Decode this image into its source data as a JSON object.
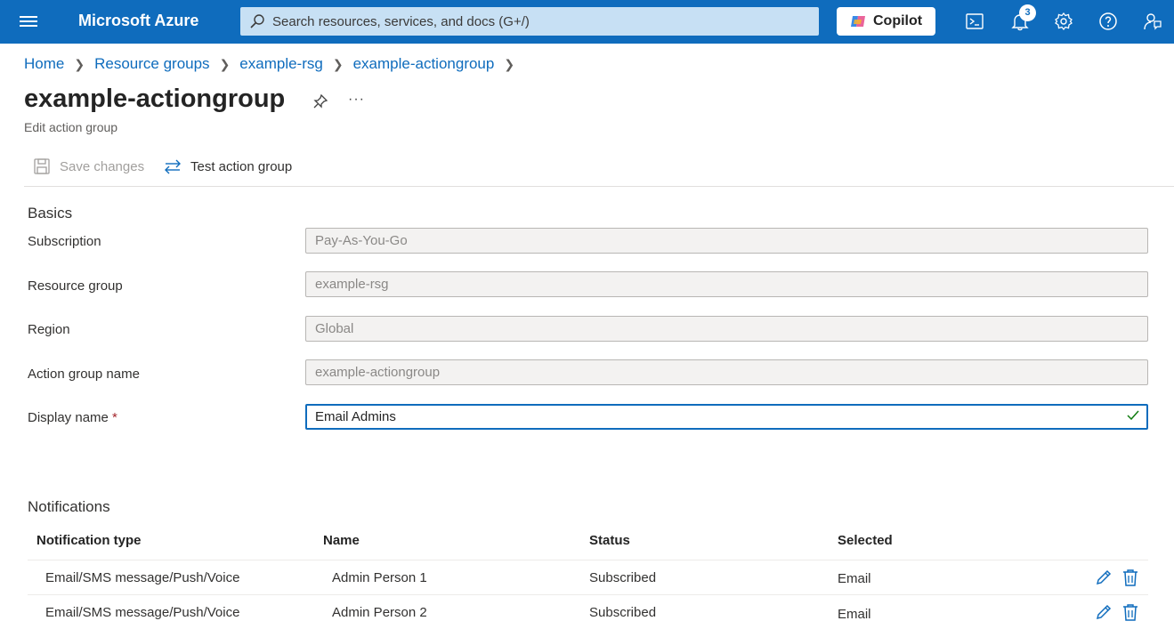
{
  "topbar": {
    "brand": "Microsoft Azure",
    "search_placeholder": "Search resources, services, and docs (G+/)",
    "copilot_label": "Copilot",
    "notification_count": "3"
  },
  "breadcrumb": [
    "Home",
    "Resource groups",
    "example-rsg",
    "example-actiongroup"
  ],
  "page": {
    "title": "example-actiongroup",
    "subtitle": "Edit action group",
    "more": "···"
  },
  "commands": {
    "save": "Save changes",
    "test": "Test action group"
  },
  "basics": {
    "heading": "Basics",
    "subscription_label": "Subscription",
    "subscription_value": "Pay-As-You-Go",
    "resource_group_label": "Resource group",
    "resource_group_value": "example-rsg",
    "region_label": "Region",
    "region_value": "Global",
    "action_group_name_label": "Action group name",
    "action_group_name_value": "example-actiongroup",
    "display_name_label": "Display name",
    "required_marker": "*",
    "display_name_value": "Email Admins"
  },
  "notifications": {
    "heading": "Notifications",
    "columns": [
      "Notification type",
      "Name",
      "Status",
      "Selected"
    ],
    "rows": [
      {
        "type": "Email/SMS message/Push/Voice",
        "name": "Admin Person 1",
        "status": "Subscribed",
        "selected": "Email"
      },
      {
        "type": "Email/SMS message/Push/Voice",
        "name": "Admin Person 2",
        "status": "Subscribed",
        "selected": "Email"
      }
    ]
  },
  "colors": {
    "brand_blue": "#0f6cbd",
    "success_green": "#107c10",
    "required_red": "#a4262c"
  }
}
